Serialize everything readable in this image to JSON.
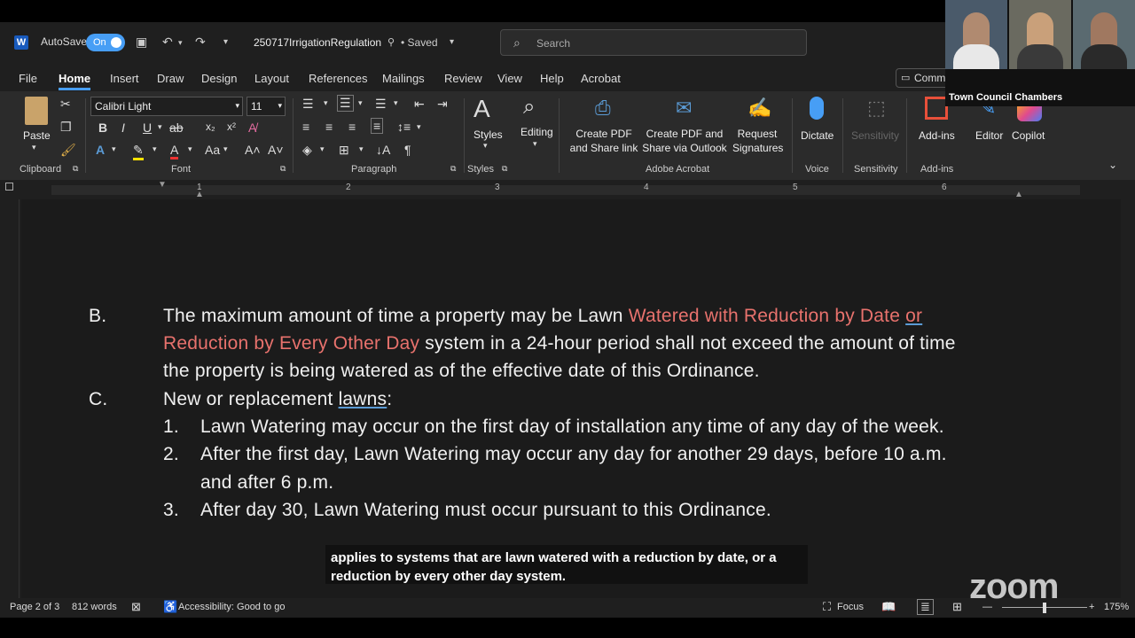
{
  "titlebar": {
    "autosave_label": "AutoSave",
    "autosave_state": "On",
    "document_title": "250717IrrigationRegulation",
    "save_status": "• Saved",
    "search_placeholder": "Search"
  },
  "tabs": [
    "File",
    "Home",
    "Insert",
    "Draw",
    "Design",
    "Layout",
    "References",
    "Mailings",
    "Review",
    "View",
    "Help",
    "Acrobat"
  ],
  "active_tab": "Home",
  "comments_label": "Comm",
  "ribbon": {
    "clipboard": {
      "paste": "Paste",
      "group": "Clipboard"
    },
    "font": {
      "name": "Calibri Light",
      "size": "11",
      "group": "Font"
    },
    "paragraph": {
      "group": "Paragraph"
    },
    "styles": {
      "label": "Styles",
      "group": "Styles"
    },
    "editing": {
      "label": "Editing"
    },
    "acrobat": {
      "create_pdf_share_link": "Create PDF and Share link",
      "create_pdf_outlook": "Create PDF and Share via Outlook",
      "request_signatures": "Request Signatures",
      "group": "Adobe Acrobat"
    },
    "voice": {
      "dictate": "Dictate",
      "group": "Voice"
    },
    "sensitivity": {
      "label": "Sensitivity",
      "group": "Sensitivity"
    },
    "addins": {
      "label": "Add-ins",
      "group": "Add-ins"
    },
    "editor": "Editor",
    "copilot": "Copilot"
  },
  "ruler_numbers": [
    "1",
    "2",
    "3",
    "4",
    "5",
    "6"
  ],
  "document": {
    "item_b_label": "B.",
    "item_b_line1_a": "The maximum amount of time a property may be Lawn ",
    "item_b_line1_red": "Watered with Reduction by Date ",
    "item_b_line1_red_ul": "or",
    "item_b_line2_red": "Reduction by Every Other Day",
    "item_b_line2_b": " system in a 24-hour period shall not exceed the amount of time",
    "item_b_line3": "the property is being watered as of the effective date of this Ordinance.",
    "item_c_label": "C.",
    "item_c_text_a": "New or replacement ",
    "item_c_text_ul": "lawns",
    "item_c_text_b": ":",
    "list": [
      {
        "num": "1.",
        "line1": "Lawn Watering may occur on the first day of installation any time of any day of the week."
      },
      {
        "num": "2.",
        "line1": "After the first day, Lawn Watering may occur any day for another 29 days, before 10 a.m.",
        "line2": "and after 6 p.m."
      },
      {
        "num": "3.",
        "line1": "After day 30, Lawn Watering must occur pursuant to this Ordinance."
      }
    ]
  },
  "caption": "applies to systems that are lawn watered with a reduction by date, or a reduction by every other day system.",
  "statusbar": {
    "page": "Page 2 of 3",
    "words": "812 words",
    "accessibility": "Accessibility: Good to go",
    "focus": "Focus",
    "zoom": "175%"
  },
  "video": {
    "label": "Town Council Chambers"
  },
  "overlay_logo": "zoom"
}
